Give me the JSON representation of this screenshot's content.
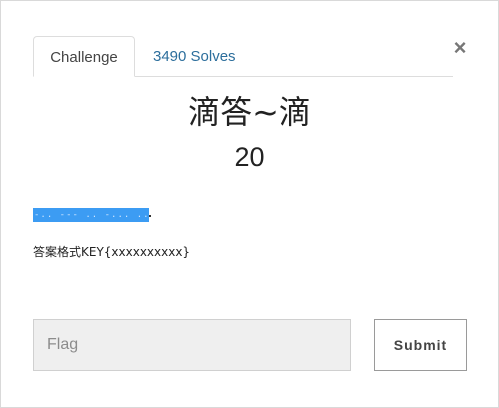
{
  "tabs": [
    {
      "label": "Challenge"
    },
    {
      "label": "3490 Solves"
    }
  ],
  "close_icon": "×",
  "challenge": {
    "name": "滴答~滴",
    "value": "20",
    "highlighted_text": "-.. --- .. -... ..- ... -.--",
    "description": "答案格式KEY{xxxxxxxxxx}"
  },
  "flag": {
    "placeholder": "Flag",
    "value": ""
  },
  "submit_label": "Submit",
  "colors": {
    "tab_link": "#2c6e9c",
    "selection": "#3c9cf3"
  }
}
